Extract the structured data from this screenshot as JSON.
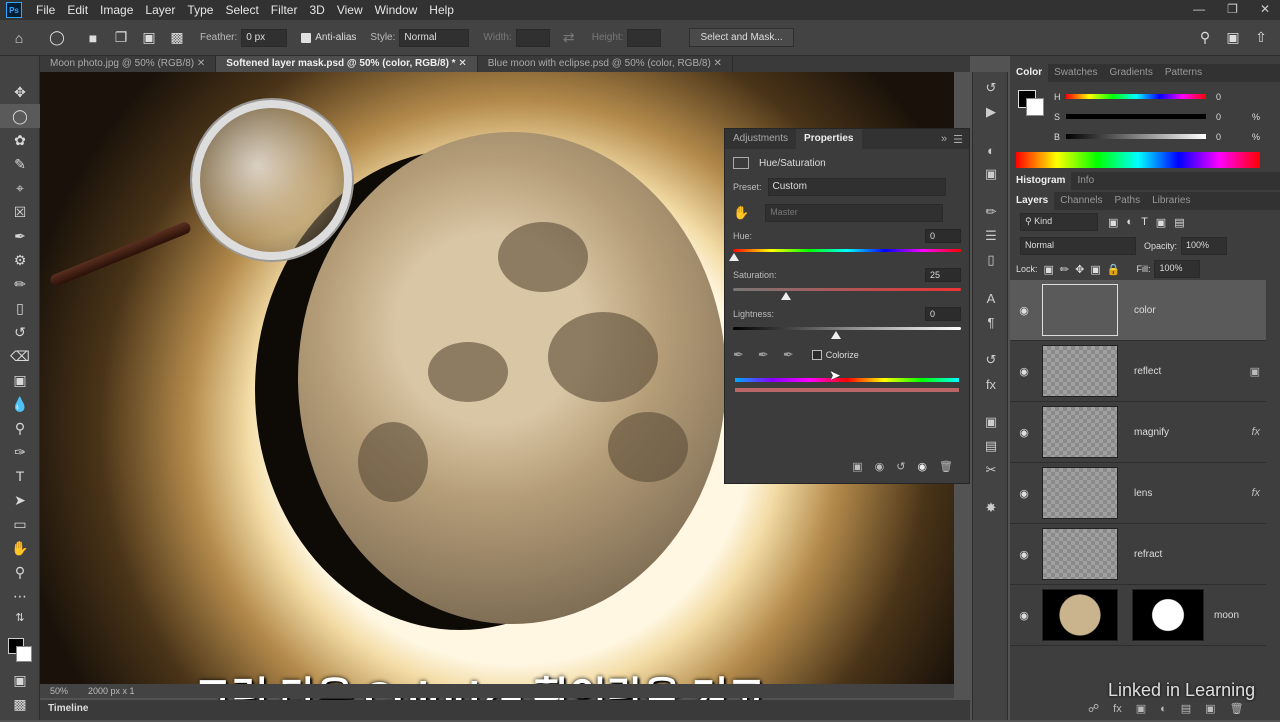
{
  "menubar": {
    "logo": "Ps",
    "items": [
      "File",
      "Edit",
      "Image",
      "Layer",
      "Type",
      "Select",
      "Filter",
      "3D",
      "View",
      "Window",
      "Help"
    ]
  },
  "options": {
    "feather_label": "Feather:",
    "feather_value": "0 px",
    "antialias_label": "Anti-alias",
    "style_label": "Style:",
    "style_value": "Normal",
    "width_label": "Width:",
    "height_label": "Height:",
    "select_mask_label": "Select and Mask..."
  },
  "doc_tabs": [
    {
      "label": "Moon photo.jpg @ 50% (RGB/8)",
      "active": false
    },
    {
      "label": "Softened layer mask.psd @ 50% (color, RGB/8) *",
      "active": true
    },
    {
      "label": "Blue moon with eclipse.psd @ 50% (color, RGB/8)",
      "active": false
    }
  ],
  "status": {
    "zoom": "50%",
    "size": "2000 px x 1"
  },
  "timeline_label": "Timeline",
  "caption": "그런 다음 Colorize 확인란을 켜고",
  "properties": {
    "tab_adjustments": "Adjustments",
    "tab_properties": "Properties",
    "panel_title": "Hue/Saturation",
    "preset_label": "Preset:",
    "preset_value": "Custom",
    "channel_value": "Master",
    "hue_label": "Hue:",
    "hue_value": "0",
    "saturation_label": "Saturation:",
    "saturation_value": "25",
    "lightness_label": "Lightness:",
    "lightness_value": "0",
    "colorize_label": "Colorize"
  },
  "color_panel": {
    "tabs": [
      "Color",
      "Swatches",
      "Gradients",
      "Patterns"
    ],
    "h_label": "H",
    "h_value": "0",
    "s_label": "S",
    "s_value": "0",
    "b_label": "B",
    "b_value": "0",
    "percent": "%"
  },
  "histogram_tabs": [
    "Histogram",
    "Info"
  ],
  "layers_panel": {
    "tabs": [
      "Layers",
      "Channels",
      "Paths",
      "Libraries"
    ],
    "kind_label": "Kind",
    "blend_mode": "Normal",
    "opacity_label": "Opacity:",
    "opacity_value": "100%",
    "lock_label": "Lock:",
    "fill_label": "Fill:",
    "fill_value": "100%",
    "layers": [
      {
        "name": "color",
        "fx": ""
      },
      {
        "name": "reflect",
        "fx": ""
      },
      {
        "name": "magnify",
        "fx": "fx"
      },
      {
        "name": "lens",
        "fx": "fx"
      },
      {
        "name": "refract",
        "fx": ""
      },
      {
        "name": "moon",
        "fx": ""
      }
    ]
  },
  "watermark": "Linked in Learning"
}
